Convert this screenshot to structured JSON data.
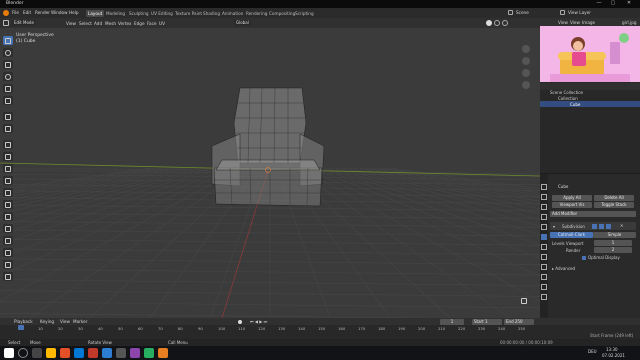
{
  "app": {
    "title": "Blender",
    "min_label": "—",
    "max_label": "▢",
    "close_label": "✕"
  },
  "menus": [
    "File",
    "Edit",
    "Render",
    "Window",
    "Help"
  ],
  "workspaces": {
    "active": "Layout",
    "tabs": [
      "Layout",
      "Modeling",
      "Sculpting",
      "UV Editing",
      "Texture Paint",
      "Shading",
      "Animation",
      "Rendering",
      "Compositing",
      "Scripting"
    ]
  },
  "topbar_right": {
    "scene_label": "Scene",
    "viewlayer_label": "View Layer"
  },
  "viewport_header": {
    "mode": "Edit Mode",
    "menu": [
      "View",
      "Select",
      "Add",
      "Mesh",
      "Vertex",
      "Edge",
      "Face",
      "UV"
    ],
    "orientation": "Global"
  },
  "viewport_overlay": {
    "view_name": "User Perspective",
    "object_name": "(1) Cube"
  },
  "outliner": {
    "header_items": [
      "View",
      "View",
      "Image"
    ],
    "image_label": "girl.jpg",
    "rows": [
      "Scene Collection",
      "Collection",
      "Cube"
    ]
  },
  "properties": {
    "object_name": "Cube",
    "buttons": {
      "apply_all": "Apply All",
      "delete_all": "Delete All",
      "viewport_vis": "Viewport Vis",
      "toggle_stack": "Toggle Stack"
    },
    "add_modifier": "Add Modifier",
    "modifier_name": "Subdivision",
    "subdiv_types": [
      "Catmull-Clark",
      "Simple"
    ],
    "levels_viewport_label": "Levels Viewport",
    "levels_viewport_value": "1",
    "render_label": "Render",
    "render_value": "2",
    "optimal_display": "Optimal Display",
    "advanced_label": "Advanced"
  },
  "timeline": {
    "menu": [
      "Playback",
      "Keying",
      "View",
      "Marker"
    ],
    "current_frame": "1",
    "start_label": "Start",
    "start_value": "1",
    "end_label": "End",
    "end_value": "250",
    "ticks": [
      "0",
      "10",
      "20",
      "30",
      "40",
      "50",
      "60",
      "70",
      "80",
      "90",
      "100",
      "110",
      "120",
      "130",
      "140",
      "150",
      "160",
      "170",
      "180",
      "190",
      "200",
      "210",
      "220",
      "230",
      "240",
      "250"
    ],
    "version": "2.92.0"
  },
  "statusbar": {
    "select_label": "Select",
    "move_label": "Move",
    "rotate_label": "Rotate View",
    "menu_label": "Call Menu",
    "right_info": "00:00:00:00 / 00:00:10:09",
    "frame_info": "Start Frame (249 left)"
  },
  "taskbar": {
    "time": "13:30",
    "date": "07.02.2021",
    "lang": "DEU"
  },
  "colors": {
    "accent": "#4772b3",
    "x_axis": "#8b3a3a",
    "y_axis": "#6e8a2c"
  }
}
